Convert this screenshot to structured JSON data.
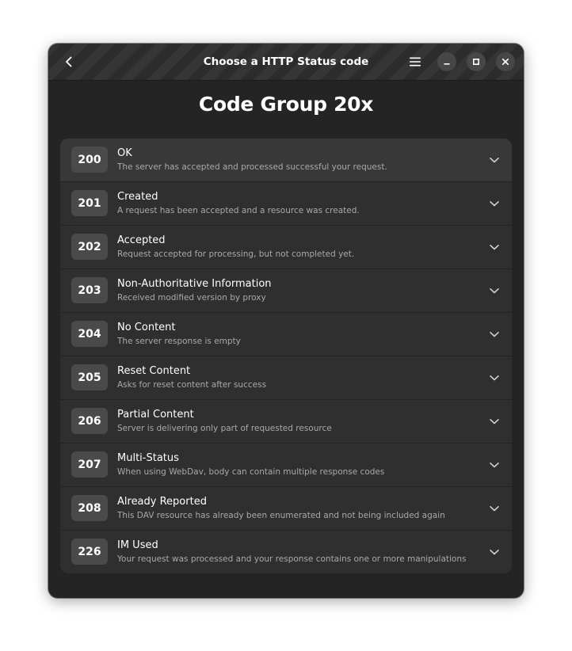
{
  "window": {
    "title": "Choose a HTTP Status code"
  },
  "heading": "Code Group 20x",
  "icons": {
    "back": "chevron-left-icon",
    "menu": "hamburger-menu-icon",
    "minimize": "minimize-icon",
    "maximize": "maximize-icon",
    "close": "close-icon",
    "expand": "chevron-down-icon"
  },
  "colors": {
    "window_bg": "#242424",
    "header_bg": "#2e2e2e",
    "list_bg": "#2f2f2f",
    "badge_bg": "#4a4a4a",
    "text": "#ffffff",
    "subtext": "#a9a9a9"
  },
  "codes": [
    {
      "code": "200",
      "title": "OK",
      "description": "The server has accepted and processed successful your request."
    },
    {
      "code": "201",
      "title": "Created",
      "description": "A request has been accepted and a resource was created."
    },
    {
      "code": "202",
      "title": "Accepted",
      "description": "Request accepted for processing, but not completed yet."
    },
    {
      "code": "203",
      "title": "Non-Authoritative Information",
      "description": "Received modified version by proxy"
    },
    {
      "code": "204",
      "title": "No Content",
      "description": "The server response is empty"
    },
    {
      "code": "205",
      "title": "Reset Content",
      "description": "Asks for reset content after success"
    },
    {
      "code": "206",
      "title": "Partial Content",
      "description": "Server is delivering only part of requested resource"
    },
    {
      "code": "207",
      "title": "Multi-Status",
      "description": "When using WebDav, body can contain multiple response codes"
    },
    {
      "code": "208",
      "title": "Already Reported",
      "description": "This DAV resource has already been enumerated and not being included again"
    },
    {
      "code": "226",
      "title": "IM Used",
      "description": "Your request was processed and your response contains one or more manipulations"
    }
  ]
}
